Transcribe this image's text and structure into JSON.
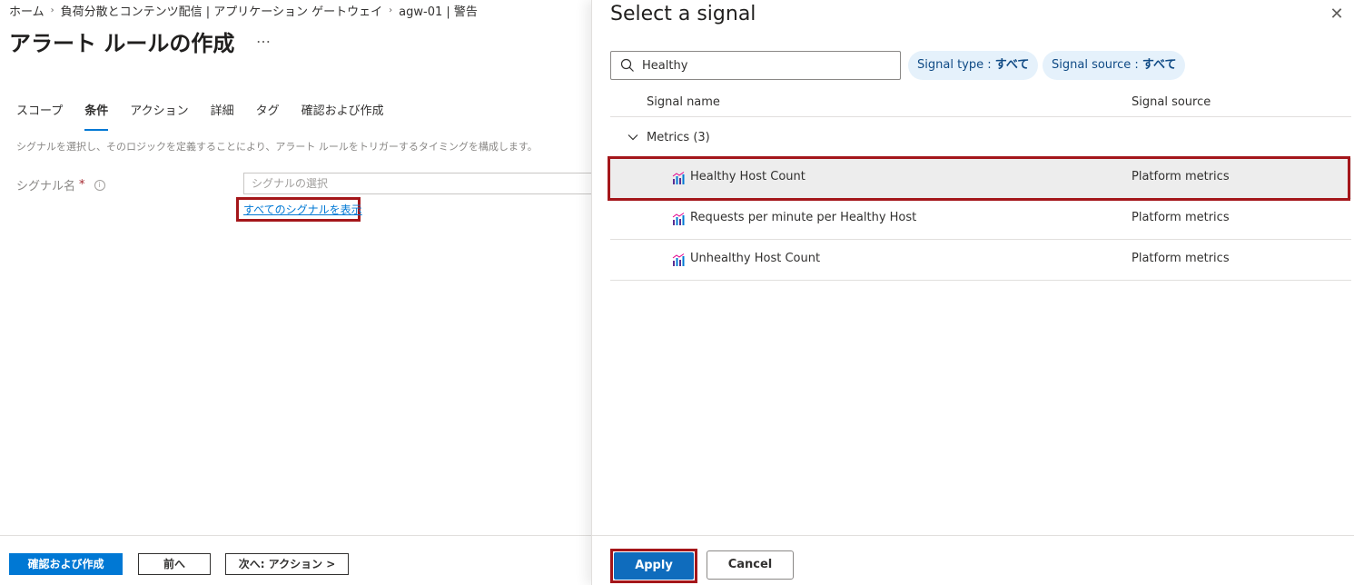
{
  "breadcrumb": [
    "ホーム",
    "負荷分散とコンテンツ配信 | アプリケーション ゲートウェイ",
    "agw-01 | 警告"
  ],
  "page": {
    "title": "アラート ルールの作成",
    "more": "…",
    "tabs": [
      "スコープ",
      "条件",
      "アクション",
      "詳細",
      "タグ",
      "確認および作成"
    ],
    "active_tab": "条件",
    "description": "シグナルを選択し、そのロジックを定義することにより、アラート ルールをトリガーするタイミングを構成します。",
    "signal_label": "シグナル名",
    "required_mark": "*",
    "info_glyph": "i",
    "signal_placeholder": "シグナルの選択",
    "show_all_link": "すべてのシグナルを表示",
    "footer": {
      "review_create": "確認および作成",
      "previous": "前へ",
      "next": "次へ: アクション >"
    }
  },
  "panel": {
    "title": "Select a signal",
    "close_glyph": "✕",
    "search_value": "Healthy",
    "filters": [
      {
        "label": "Signal type : ",
        "value": "すべて"
      },
      {
        "label": "Signal source : ",
        "value": "すべて"
      }
    ],
    "columns": {
      "name": "Signal name",
      "source": "Signal source"
    },
    "group": "Metrics (3)",
    "rows": [
      {
        "name": "Healthy Host Count",
        "source": "Platform metrics"
      },
      {
        "name": "Requests per minute per Healthy Host",
        "source": "Platform metrics"
      },
      {
        "name": "Unhealthy Host Count",
        "source": "Platform metrics"
      }
    ],
    "apply": "Apply",
    "cancel": "Cancel"
  },
  "colors": {
    "accent": "#0078d4",
    "highlight_frame": "#a4161a",
    "pill_bg": "#e5f1fb"
  }
}
